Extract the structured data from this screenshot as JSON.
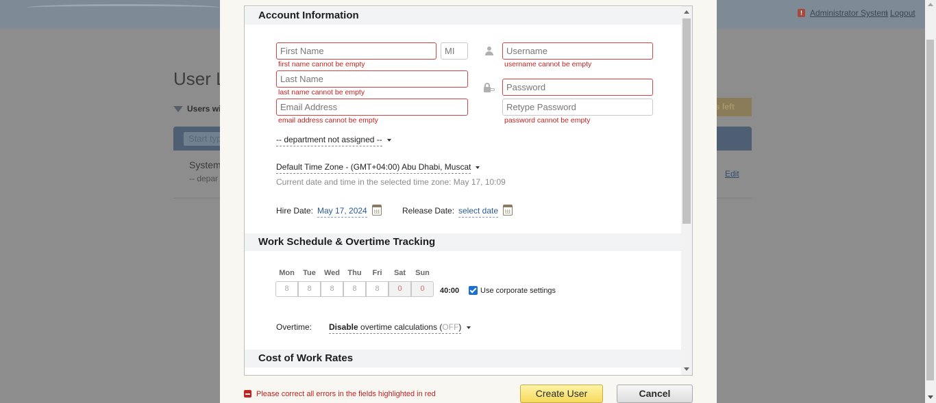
{
  "background": {
    "admin_user": "Administrator System",
    "separator": "|",
    "logout": "Logout",
    "alert_icon": "exclamation-icon",
    "page_title": "User L",
    "filter_label": "Users wi",
    "badge": "ts left",
    "search_placeholder": "Start typ",
    "row_name": "System",
    "row_dept": "-- depar",
    "edit": "Edit"
  },
  "dialog": {
    "account_section": "Account Information",
    "first_name_placeholder": "First Name",
    "mi_placeholder": "MI",
    "first_name_error": "first name cannot be empty",
    "last_name_placeholder": "Last Name",
    "last_name_error": "last name cannot be empty",
    "email_placeholder": "Email Address",
    "email_error": "email address cannot be empty",
    "username_placeholder": "Username",
    "username_error": "username cannot be empty",
    "password_placeholder": "Password",
    "retype_password_placeholder": "Retype Password",
    "password_error": "password cannot be empty",
    "department": "-- department not assigned --",
    "timezone": "Default Time Zone - (GMT+04:00) Abu Dhabi, Muscat",
    "timezone_note": "Current date and time in the selected time zone: May 17, 10:09",
    "hire_date_label": "Hire Date:",
    "hire_date_value": "May 17, 2024",
    "release_date_label": "Release Date:",
    "release_date_value": "select date",
    "schedule_section": "Work Schedule & Overtime Tracking",
    "days": [
      {
        "label": "Mon",
        "hours": "8"
      },
      {
        "label": "Tue",
        "hours": "8"
      },
      {
        "label": "Wed",
        "hours": "8"
      },
      {
        "label": "Thu",
        "hours": "8"
      },
      {
        "label": "Fri",
        "hours": "8"
      },
      {
        "label": "Sat",
        "hours": "0"
      },
      {
        "label": "Sun",
        "hours": "0"
      }
    ],
    "total_hours": "40:00",
    "corporate_settings_label": "Use corporate settings",
    "corporate_settings_checked": true,
    "overtime_label": "Overtime:",
    "overtime_strong": "Disable",
    "overtime_text": " overtime calculations (",
    "overtime_state": "OFF",
    "overtime_close": ")",
    "cost_section": "Cost of Work Rates"
  },
  "footer": {
    "error_text": "Please correct all errors in the fields highlighted in red",
    "create_button": "Create User",
    "cancel_button": "Cancel"
  },
  "colors": {
    "error_red": "#c32020",
    "create_button": "#f5d95c",
    "link_blue": "#2a5a96"
  }
}
